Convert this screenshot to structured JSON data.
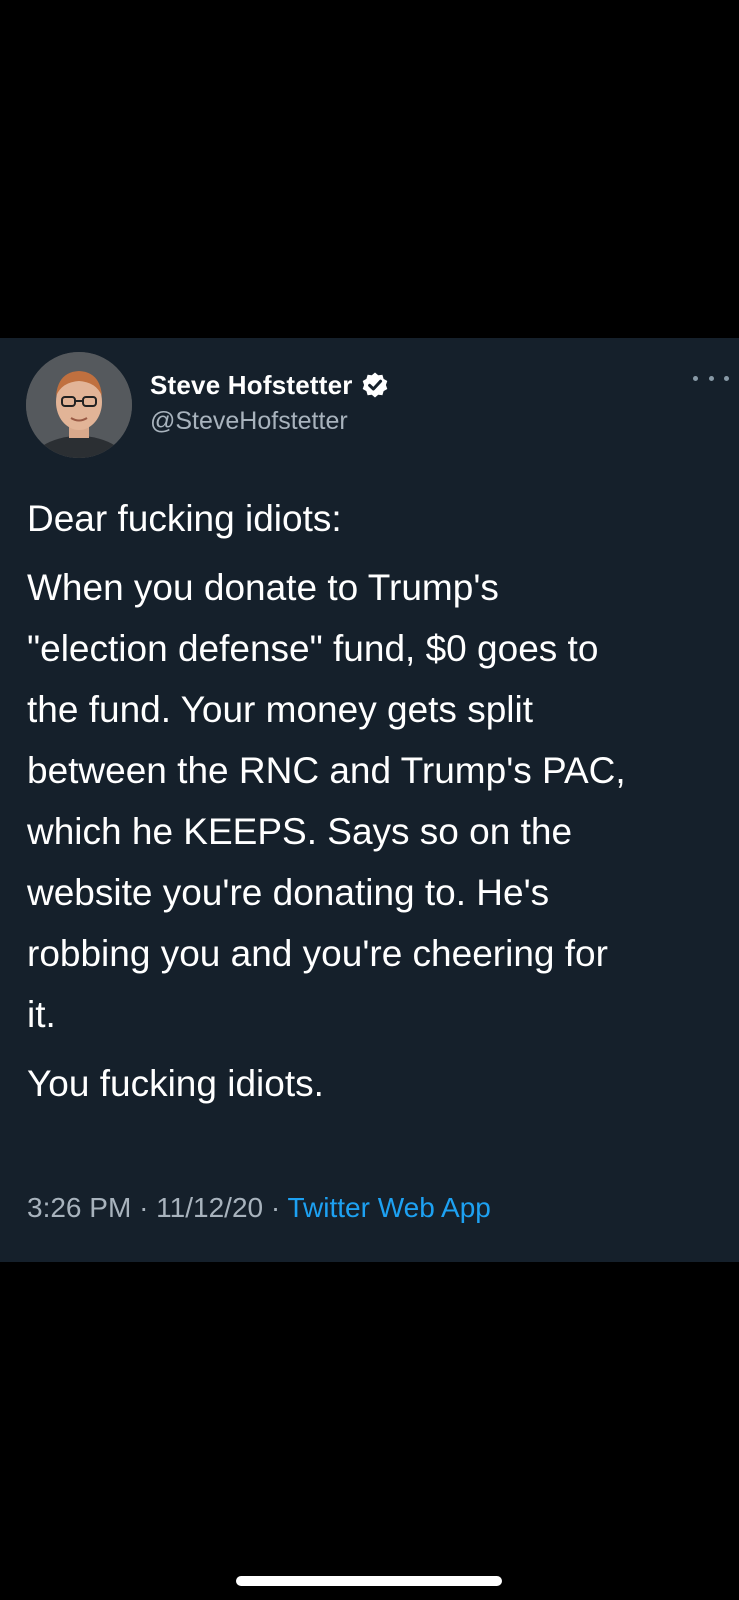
{
  "tweet": {
    "author": {
      "display_name": "Steve Hofstetter",
      "handle": "@SteveHofstetter",
      "verified": true,
      "avatar_icon": "profile-photo"
    },
    "paragraphs": [
      "Dear fucking idiots:",
      "When you donate to Trump's\n\"election defense\" fund, $0 goes to\nthe fund. Your money gets split\nbetween the RNC and Trump's PAC,\nwhich he KEEPS. Says so on the\nwebsite you're donating to. He's\nrobbing you and you're cheering for\nit.",
      "You fucking idiots."
    ],
    "time": "3:26 PM",
    "date": "11/12/20",
    "separator": "·",
    "source": "Twitter Web App"
  },
  "colors": {
    "page_background": "#000000",
    "card_background": "#15202b",
    "text_primary": "#ffffff",
    "text_secondary": "#a8b3bd",
    "link_accent": "#1da1f2"
  },
  "icons": {
    "verified": "verified-badge-icon",
    "more": "more-options-icon"
  }
}
